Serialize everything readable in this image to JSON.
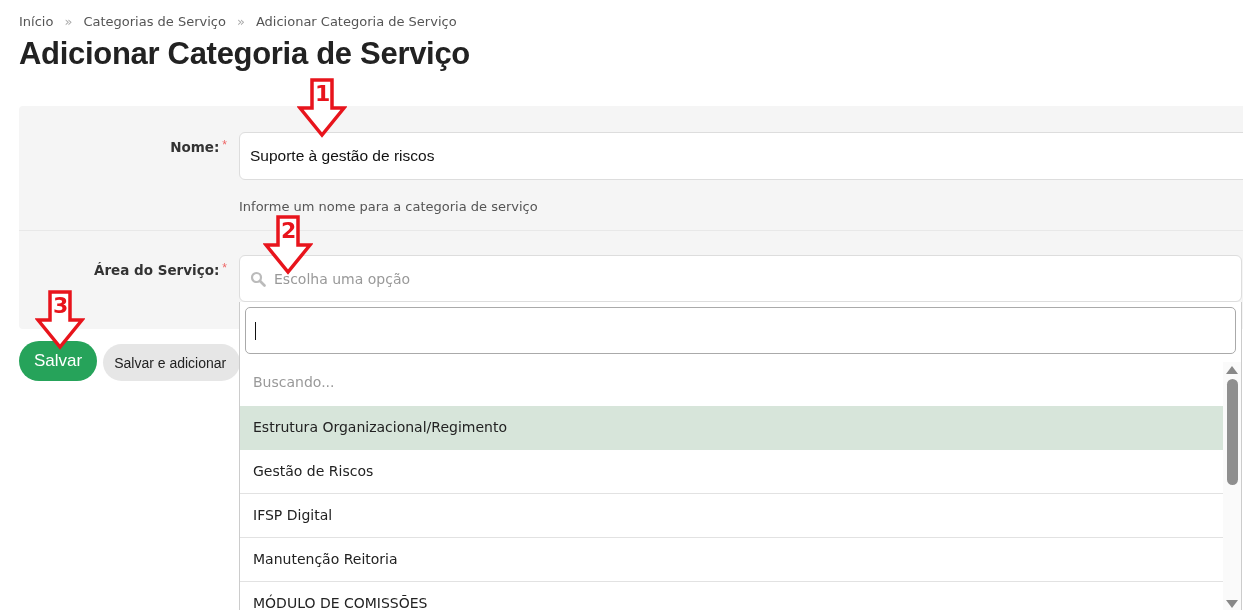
{
  "breadcrumb": [
    "Início",
    "Categorias de Serviço",
    "Adicionar Categoria de Serviço"
  ],
  "breadcrumb_separator": "»",
  "required_mark": "*",
  "title": "Adicionar Categoria de Serviço",
  "fields": [
    {
      "kind": "text",
      "label": "Nome:",
      "required": true,
      "value": "Suporte à gestão de riscos",
      "help": "Informe um nome para a categoria de serviço",
      "callout": "1"
    },
    {
      "kind": "select",
      "label": "Área do Serviço:",
      "required": true,
      "placeholder": "Escolha uma opção",
      "callout": "2",
      "expanded": true,
      "status": "Buscando...",
      "options": [
        {
          "label": "Estrutura Organizacional/Regimento",
          "selected": true
        },
        {
          "label": "Gestão de Riscos",
          "selected": false
        },
        {
          "label": "IFSP Digital",
          "selected": false
        },
        {
          "label": "Manutenção Reitoria",
          "selected": false
        },
        {
          "label": "MÓDULO DE COMISSÕES",
          "selected": false
        }
      ]
    }
  ],
  "buttons": [
    {
      "kind": "primary",
      "label": "Salvar",
      "callout": "3"
    },
    {
      "kind": "secondary",
      "label": "Salvar e adicionar"
    }
  ]
}
